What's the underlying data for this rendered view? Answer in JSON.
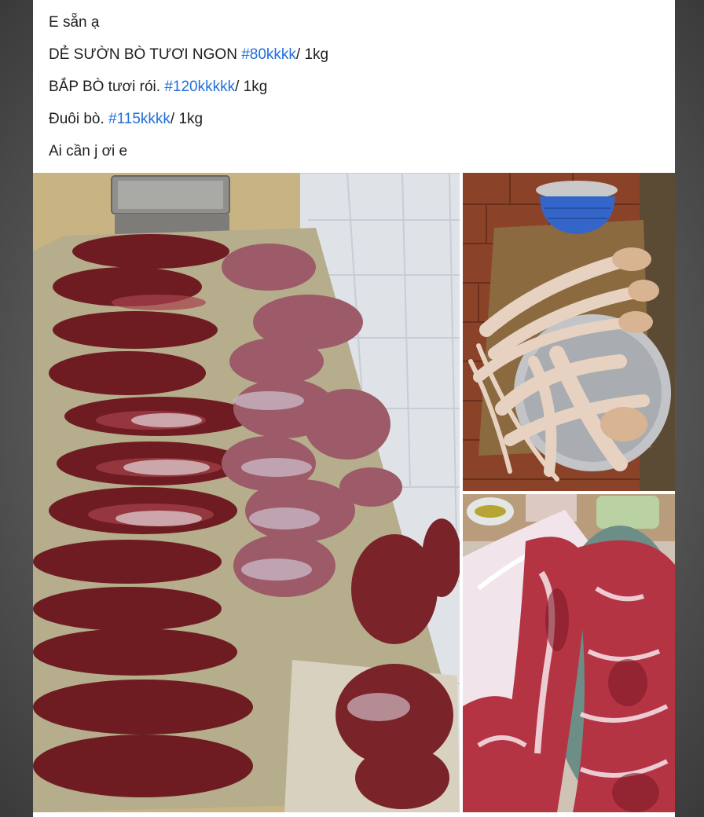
{
  "post": {
    "lines": [
      {
        "text": "E sẵn ạ",
        "hashtag": "",
        "suffix": ""
      },
      {
        "text": "DẺ SƯỜN BÒ TƯƠI NGON ",
        "hashtag": "#80kkkk",
        "suffix": "/ 1kg"
      },
      {
        "text": "BẮP BÒ tươi rói. ",
        "hashtag": "#120kkkkk",
        "suffix": "/ 1kg"
      },
      {
        "text": "Đuôi bò. ",
        "hashtag": "#115kkkk",
        "suffix": "/ 1kg"
      },
      {
        "text": "Ai cần j ơi e",
        "hashtag": "",
        "suffix": ""
      }
    ]
  },
  "colors": {
    "hashtag": "#216fdb",
    "text": "#1c1e21"
  },
  "photos": [
    {
      "name": "beef-cuts-on-floor-photo",
      "subject": "raw beef cuts laid on towels"
    },
    {
      "name": "beef-tails-in-bowl-photo",
      "subject": "beef tails in a metal bowl"
    },
    {
      "name": "sliced-beef-ribs-photo",
      "subject": "sliced raw beef rib meat"
    }
  ]
}
